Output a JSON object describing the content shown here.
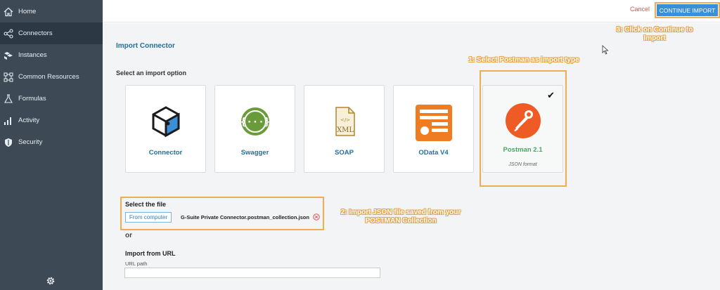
{
  "sidebar": {
    "items": [
      {
        "label": "Home",
        "icon": "home-icon"
      },
      {
        "label": "Connectors",
        "icon": "connectors-icon",
        "active": true
      },
      {
        "label": "Instances",
        "icon": "instances-icon"
      },
      {
        "label": "Common Resources",
        "icon": "common-resources-icon"
      },
      {
        "label": "Formulas",
        "icon": "flask-icon"
      },
      {
        "label": "Activity",
        "icon": "bar-chart-icon"
      },
      {
        "label": "Security",
        "icon": "shield-icon"
      }
    ],
    "footer_icon": "gear-icon"
  },
  "header": {
    "cancel_label": "Cancel",
    "continue_label": "CONTINUE IMPORT"
  },
  "main": {
    "title": "Import Connector",
    "import_option_label": "Select an import option",
    "options": [
      {
        "label": "Connector",
        "icon": "cube-icon"
      },
      {
        "label": "Swagger",
        "icon": "swagger-icon"
      },
      {
        "label": "SOAP",
        "icon": "xml-file-icon"
      },
      {
        "label": "OData V4",
        "icon": "odata-icon"
      },
      {
        "label": "Postman 2.1",
        "sublabel": "JSON format",
        "icon": "postman-icon",
        "selected": true
      }
    ],
    "file_section": {
      "title": "Select the file",
      "button_label": "From computer",
      "file_name": "G-Suite Private Connector.postman_collection.json"
    },
    "or_label": "or",
    "url_section": {
      "title": "Import from URL",
      "sublabel": "URL path",
      "value": ""
    }
  },
  "annotations": {
    "step1": "1: Select Postman as import type",
    "step2_line1": "2: Import JSON file saved from your",
    "step2_line2": "POSTMAN Collection",
    "step3_line1": "3: Click on Continue to",
    "step3_line2": "Import"
  },
  "colors": {
    "sidebar_bg": "#3d4a56",
    "accent_blue": "#3a8fd6",
    "highlight_orange": "#f0ad4e",
    "postman_orange": "#ef5b25",
    "swagger_green": "#6a9b3a",
    "odata_orange": "#f07c22",
    "postman_label_green": "#4aa564"
  }
}
